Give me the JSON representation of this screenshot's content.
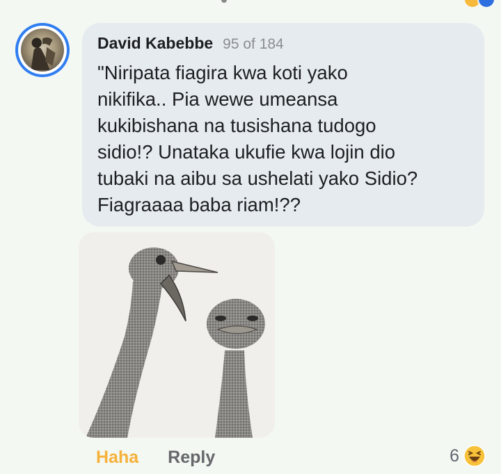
{
  "comment": {
    "author": "David Kabebbe",
    "counter": "95 of 184",
    "text": "\"Niripata fiagira kwa koti yako\nnikifika.. Pia wewe umeansa\nkukibishana na tusishana tudogo\nsidio!? Unataka ukufie kwa lojin dio\ntubaki na aibu sa ushelati yako Sidio?\nFiagraaaa baba riam!??"
  },
  "actions": {
    "reaction_label": "Haha",
    "reply_label": "Reply"
  },
  "reactions": {
    "count": "6",
    "icon": "haha-emoji-icon"
  },
  "colors": {
    "background": "#f3f8f2",
    "bubble": "#e6ebef",
    "haha_accent": "#f5b13b",
    "avatar_ring": "#2f7df1"
  }
}
